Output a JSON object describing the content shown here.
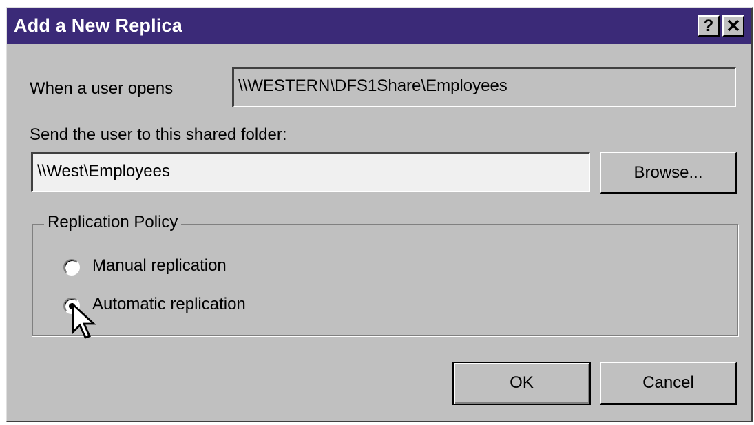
{
  "dialog": {
    "title": "Add a New Replica",
    "help_button": "?",
    "close_button": "✕"
  },
  "source": {
    "label": "When a user opens",
    "value": "\\\\WESTERN\\DFS1Share\\Employees"
  },
  "target": {
    "label": "Send the user to this shared folder:",
    "value": "\\\\West\\Employees",
    "browse_label": "Browse..."
  },
  "replication_policy": {
    "legend": "Replication Policy",
    "options": [
      {
        "label": "Manual replication",
        "selected": false
      },
      {
        "label": "Automatic replication",
        "selected": true
      }
    ]
  },
  "buttons": {
    "ok": "OK",
    "cancel": "Cancel"
  },
  "colors": {
    "titlebar": "#3b2a78",
    "face": "#c0c0c0"
  },
  "icons": {
    "cursor": "mouse-pointer-icon"
  }
}
